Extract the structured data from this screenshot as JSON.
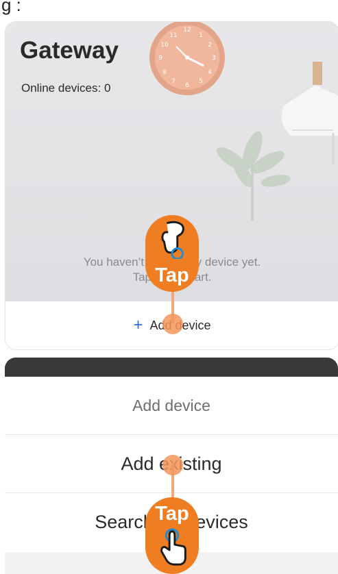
{
  "top_fragment": "g :",
  "gateway": {
    "title": "Gateway",
    "online_devices": "Online devices: 0",
    "empty_line1": "You haven’t added any device yet.",
    "empty_line2": "Tap “+” to start.",
    "add_device_button": "Add device",
    "plus_symbol": "+"
  },
  "menu": {
    "title": "Add device",
    "items": [
      {
        "label": "Add existing"
      },
      {
        "label": "Search for devices"
      }
    ]
  },
  "tap_hints": [
    {
      "label": "Tap",
      "target": "Add device"
    },
    {
      "label": "Tap",
      "target": "Add existing"
    }
  ],
  "colors": {
    "tap_badge": "#ef7d22",
    "tap_ring": "#1e8bd6",
    "plus_accent": "#2e6fd8",
    "dark_strip": "#3a3a3a"
  }
}
